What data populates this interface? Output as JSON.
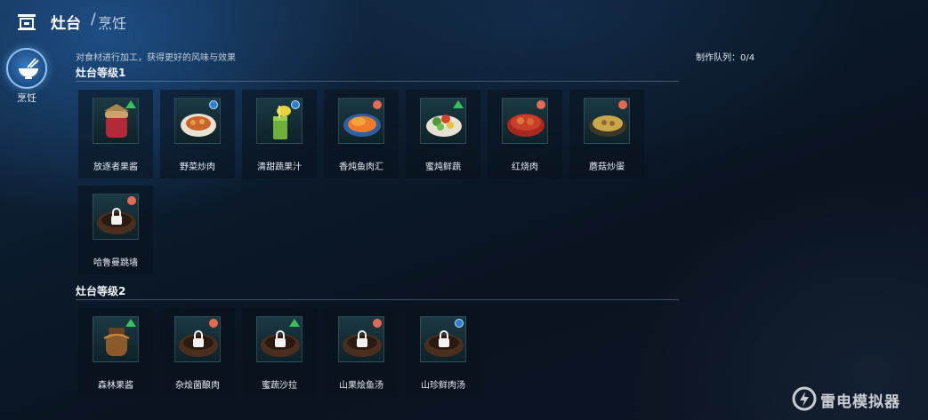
{
  "header": {
    "title": "灶台",
    "separator": "/",
    "subtitle": "烹饪",
    "home_icon": "stove-icon"
  },
  "side_tab": {
    "label": "烹饪",
    "icon": "cooking-bowl-icon"
  },
  "description": "对食材进行加工，获得更好的风味与效果",
  "queue": "制作队列：0/4",
  "sections": [
    {
      "title": "灶台等级1",
      "items": [
        {
          "name": "放逐者果酱",
          "badge": "green",
          "food": "jam"
        },
        {
          "name": "野菜炒肉",
          "badge": "blue",
          "food": "plate"
        },
        {
          "name": "清甜蔬果汁",
          "badge": "blue",
          "food": "juice"
        },
        {
          "name": "香炖鱼肉汇",
          "badge": "red",
          "food": "fish"
        },
        {
          "name": "蜜炖鲜蔬",
          "badge": "green",
          "food": "salad"
        },
        {
          "name": "红烧肉",
          "badge": "red",
          "food": "pot"
        },
        {
          "name": "蘑菇炒蛋",
          "badge": "red",
          "food": "omelet"
        },
        {
          "name": "哈鲁曼跳墙",
          "badge": "red",
          "food": "locked"
        }
      ]
    },
    {
      "title": "灶台等级2",
      "items": [
        {
          "name": "森林果酱",
          "badge": "green",
          "food": "jar"
        },
        {
          "name": "杂烩菌酿肉",
          "badge": "red",
          "food": "locked"
        },
        {
          "name": "蜜蔬沙拉",
          "badge": "green",
          "food": "locked"
        },
        {
          "name": "山果烩鱼汤",
          "badge": "red",
          "food": "locked"
        },
        {
          "name": "山珍鲜肉汤",
          "badge": "blue",
          "food": "locked"
        }
      ]
    }
  ],
  "watermark": {
    "text": "雷电模拟器",
    "icon": "leidian-logo-icon"
  }
}
